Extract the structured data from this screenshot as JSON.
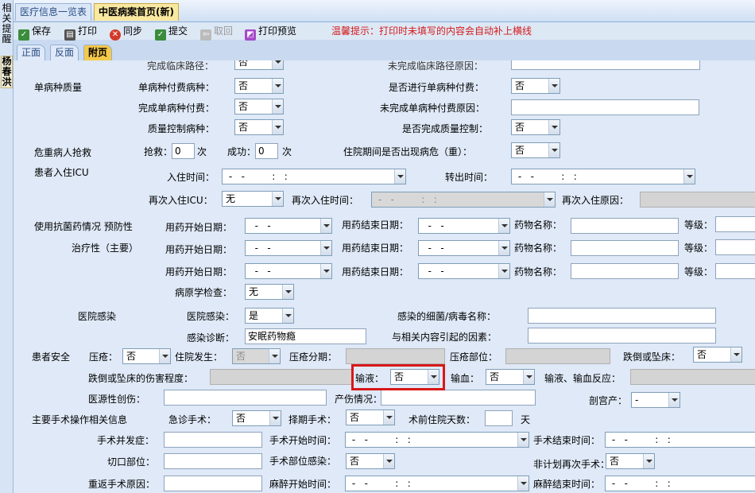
{
  "side": {
    "t1": "相关提醒",
    "t2": "杨春洪"
  },
  "tabs": [
    "医疗信息一览表",
    "中医病案首页(新)"
  ],
  "toolbar": {
    "save": "保存",
    "print": "打印",
    "sync": "同步",
    "submit": "提交",
    "cancel": "取回",
    "preview": "打印预览",
    "tip": "温馨提示：打印时未填写的内容会自动补上横线"
  },
  "subtabs": [
    "正面",
    "反面",
    "附页"
  ],
  "f": {
    "cut_a": "完成临床路径：",
    "cut_a_val": "否",
    "cut_b": "未完成临床路径原因：",
    "single": "单病种质量",
    "single_pay": "单病种付费病种：",
    "single_pay_val": "否",
    "is_pay": "是否进行单病种付费：",
    "is_pay_val": "否",
    "done_pay": "完成单病种付费：",
    "done_pay_val": "否",
    "undone_reason": "未完成单病种付费原因：",
    "qc": "质量控制病种：",
    "qc_val": "否",
    "qc_done": "是否完成质量控制：",
    "qc_done_val": "否",
    "rescue": "危重病人抢救",
    "rescue_n": "抢救：",
    "rescue_v": "0",
    "rescue_u": "次",
    "succ": "成功：",
    "succ_v": "0",
    "succ_u": "次",
    "crit": "住院期间是否出现病危（重）：",
    "crit_val": "否",
    "icu": "患者入住ICU",
    "icu_in": "入住时间：",
    "icu_in_v": " -   -         :   :",
    "icu_out": "转出时间：",
    "icu_out_v": " -   -         :   :",
    "icu_again": "再次入住ICU：",
    "icu_again_v": "无",
    "icu_again_time": "再次入住时间：",
    "icu_again_time_v": " -   -         :   :",
    "icu_again_reason": "再次入住原因：",
    "abx": "使用抗菌药情况  预防性",
    "abx_ther": "治疗性（主要）",
    "start": "用药开始日期：",
    "end": "用药结束日期：",
    "drug": "药物名称：",
    "level": "等级：",
    "date_v": "  -   -",
    "patho": "病原学检查：",
    "patho_v": "无",
    "hinf": "医院感染",
    "hinf_l": "医院感染：",
    "hinf_v": "是",
    "germ": "感染的细菌/病毒名称：",
    "diag": "感染诊断：",
    "diag_v": "安眠药物瘾",
    "factor": "与相关内容引起的因素：",
    "safety": "患者安全",
    "sore": "压疮：",
    "sore_v": "否",
    "sore_hosp": "住院发生：",
    "sore_hosp_v": "否",
    "sore_stage": "压疮分期：",
    "sore_site": "压疮部位：",
    "fall": "跌倒或坠床：",
    "fall_v": "否",
    "fall_deg": "跌倒或坠床的伤害程度：",
    "infusion": "输液：",
    "infusion_v": "否",
    "blood": "输血：",
    "blood_v": "否",
    "reaction": "输液、输血反应：",
    "iatro": "医源性创伤：",
    "birth": "产伤情况：",
    "csec": "剖宫产：",
    "csec_v": "-",
    "surg": "主要手术操作相关信息",
    "emerg": "急诊手术：",
    "emerg_v": "否",
    "elective": "择期手术：",
    "elective_v": "否",
    "preop": "术前住院天数：",
    "day": "天",
    "comp": "手术并发症：",
    "sstart": "手术开始时间：",
    "send": "手术结束时间：",
    "time_v": " -   -         :   :",
    "incision": "切口部位：",
    "sinf": "手术部位感染：",
    "sinf_v": "否",
    "unplan": "非计划再次手术：",
    "unplan_v": "否",
    "return": "重返手术原因：",
    "anes_s": "麻醉开始时间：",
    "anes_e": "麻醉结束时间："
  }
}
